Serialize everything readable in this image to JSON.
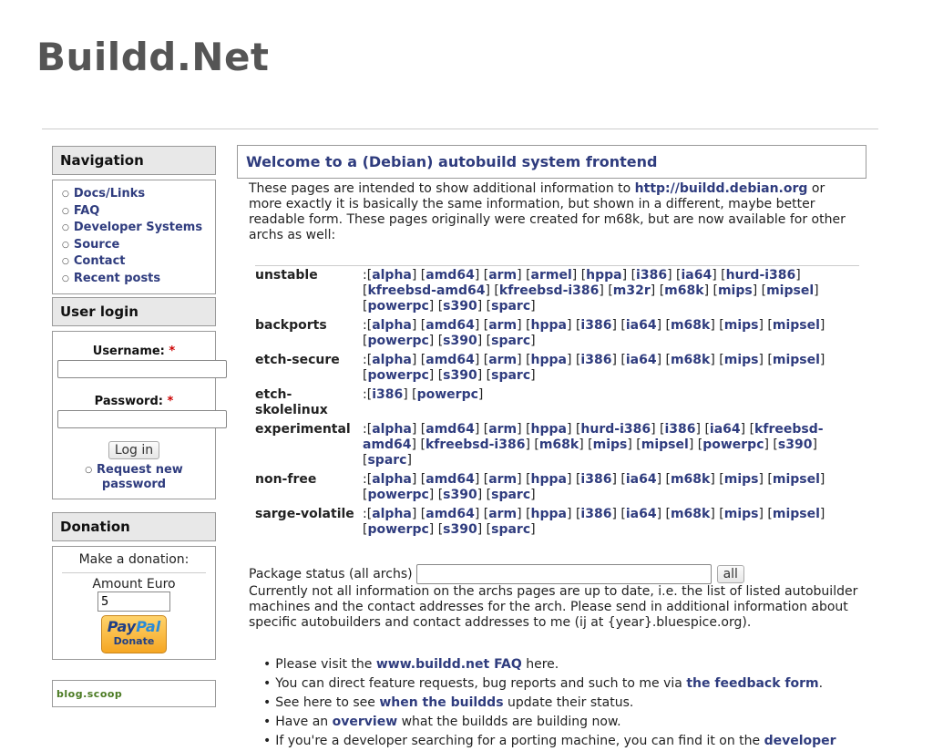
{
  "site": {
    "title": "Buildd.Net"
  },
  "navigation": {
    "title": "Navigation",
    "items": [
      "Docs/Links",
      "FAQ",
      "Developer Systems",
      "Source",
      "Contact",
      "Recent posts"
    ]
  },
  "login": {
    "title": "User login",
    "username_label": "Username:",
    "password_label": "Password:",
    "required_marker": "*",
    "login_button": "Log in",
    "request_password": "Request new password"
  },
  "donation": {
    "title": "Donation",
    "text": "Make a donation:",
    "amount_label": "Amount Euro",
    "amount_value": "5",
    "paypal_pay": "Pay",
    "paypal_pal": "Pal",
    "paypal_donate": "Donate"
  },
  "badge": {
    "text": "blog.scoop"
  },
  "main": {
    "title": "Welcome to a (Debian) autobuild system frontend",
    "intro_before": "These pages are intended to show additional information to ",
    "intro_link": "http://buildd.debian.org",
    "intro_after": " or more exactly it is basically the same information, but shown in a different, maybe better readable form. These pages originally were created for m68k, but are now available for other archs as well:",
    "distributions": [
      {
        "name": "unstable",
        "archs": [
          "alpha",
          "amd64",
          "arm",
          "armel",
          "hppa",
          "i386",
          "ia64",
          "hurd-i386",
          "kfreebsd-amd64",
          "kfreebsd-i386",
          "m32r",
          "m68k",
          "mips",
          "mipsel",
          "powerpc",
          "s390",
          "sparc"
        ]
      },
      {
        "name": "backports",
        "archs": [
          "alpha",
          "amd64",
          "arm",
          "hppa",
          "i386",
          "ia64",
          "m68k",
          "mips",
          "mipsel",
          "powerpc",
          "s390",
          "sparc"
        ]
      },
      {
        "name": "etch-secure",
        "archs": [
          "alpha",
          "amd64",
          "arm",
          "hppa",
          "i386",
          "ia64",
          "m68k",
          "mips",
          "mipsel",
          "powerpc",
          "s390",
          "sparc"
        ]
      },
      {
        "name": "etch-skolelinux",
        "archs": [
          "i386",
          "powerpc"
        ]
      },
      {
        "name": "experimental",
        "archs": [
          "alpha",
          "amd64",
          "arm",
          "hppa",
          "hurd-i386",
          "i386",
          "ia64",
          "kfreebsd-amd64",
          "kfreebsd-i386",
          "m68k",
          "mips",
          "mipsel",
          "powerpc",
          "s390",
          "sparc"
        ]
      },
      {
        "name": "non-free",
        "archs": [
          "alpha",
          "amd64",
          "arm",
          "hppa",
          "i386",
          "ia64",
          "m68k",
          "mips",
          "mipsel",
          "powerpc",
          "s390",
          "sparc"
        ]
      },
      {
        "name": "sarge-volatile",
        "archs": [
          "alpha",
          "amd64",
          "arm",
          "hppa",
          "i386",
          "ia64",
          "m68k",
          "mips",
          "mipsel",
          "powerpc",
          "s390",
          "sparc"
        ]
      }
    ],
    "package_label": "Package status (all archs)",
    "package_button": "all",
    "info_text": "Currently not all information on the archs pages are up to date, i.e. the list of listed autobuilder machines and the contact addresses for the arch. Please send in additional information about specific autobuilders and contact addresses to me (ij at {year}.bluespice.org).",
    "bullets": [
      {
        "before": "Please visit the ",
        "link": "www.buildd.net FAQ",
        "after": " here."
      },
      {
        "before": "You can direct feature requests, bug reports and such to me via ",
        "link": "the feedback form",
        "after": "."
      },
      {
        "before": "See here to see ",
        "link": "when the buildds",
        "after": " update their status."
      },
      {
        "before": "Have an ",
        "link": "overview",
        "after": " what the buildds are building now."
      },
      {
        "before": "If you're a developer searching for a porting machine, you can find it on the ",
        "link": "developer",
        "after": ""
      }
    ]
  }
}
